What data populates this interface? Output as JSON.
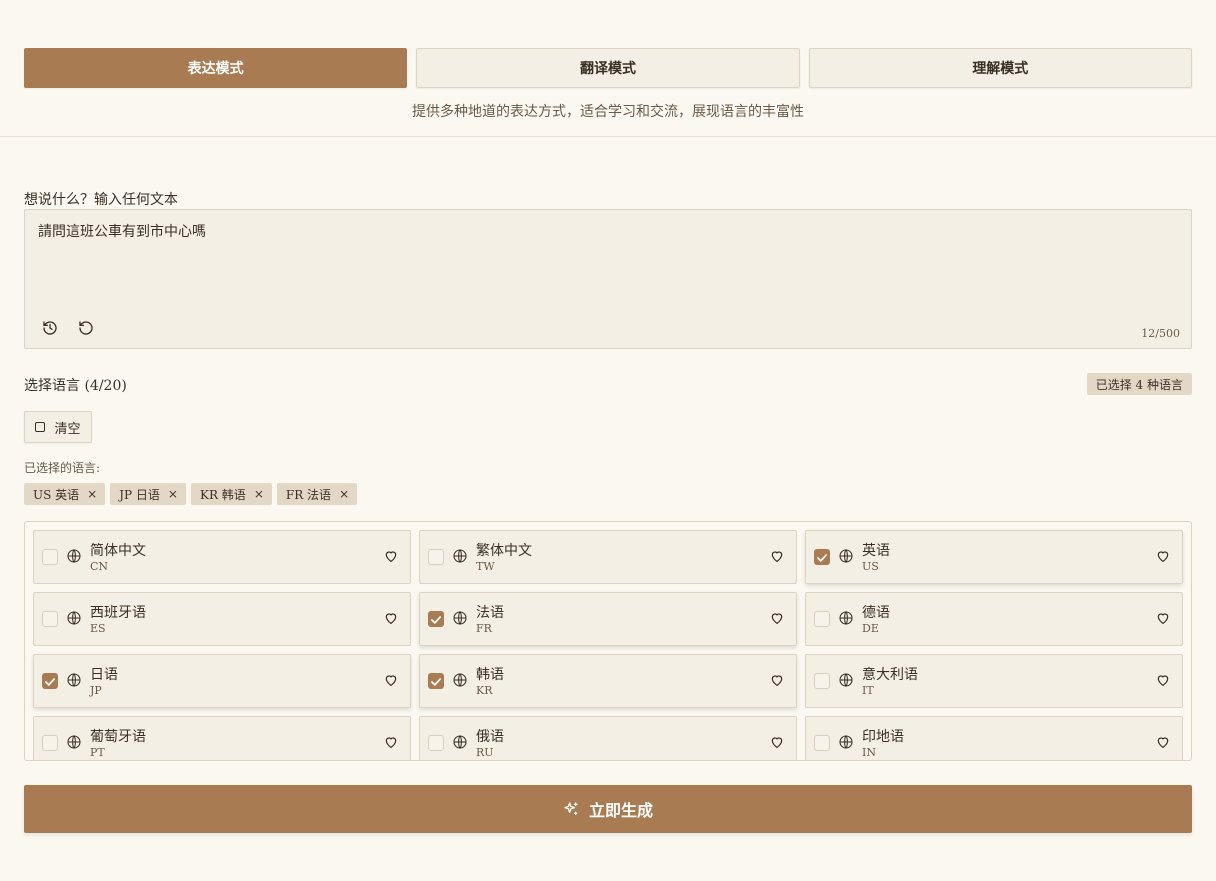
{
  "modes": [
    {
      "label": "表达模式",
      "active": true
    },
    {
      "label": "翻译模式",
      "active": false
    },
    {
      "label": "理解模式",
      "active": false
    }
  ],
  "mode_description": "提供多种地道的表达方式，适合学习和交流，展现语言的丰富性",
  "input": {
    "label": "想说什么？输入任何文本",
    "value": "請問這班公車有到市中心嗎",
    "char_count": "12/500"
  },
  "languages": {
    "title": "选择语言 (4/20)",
    "badge": "已选择 4 种语言",
    "clear_label": "清空",
    "selected_label": "已选择的语言:",
    "chips": [
      "US 英语",
      "JP 日语",
      "KR 韩语",
      "FR 法语"
    ],
    "chip_remove": "×",
    "items": [
      {
        "name": "简体中文",
        "code": "CN",
        "checked": false
      },
      {
        "name": "繁体中文",
        "code": "TW",
        "checked": false
      },
      {
        "name": "英语",
        "code": "US",
        "checked": true
      },
      {
        "name": "西班牙语",
        "code": "ES",
        "checked": false
      },
      {
        "name": "法语",
        "code": "FR",
        "checked": true
      },
      {
        "name": "德语",
        "code": "DE",
        "checked": false
      },
      {
        "name": "日语",
        "code": "JP",
        "checked": true
      },
      {
        "name": "韩语",
        "code": "KR",
        "checked": true
      },
      {
        "name": "意大利语",
        "code": "IT",
        "checked": false
      },
      {
        "name": "葡萄牙语",
        "code": "PT",
        "checked": false
      },
      {
        "name": "俄语",
        "code": "RU",
        "checked": false
      },
      {
        "name": "印地语",
        "code": "IN",
        "checked": false
      }
    ]
  },
  "generate_label": "立即生成",
  "colors": {
    "accent": "#a87b52",
    "background": "#fbf8f1",
    "card": "#f4efe4"
  }
}
